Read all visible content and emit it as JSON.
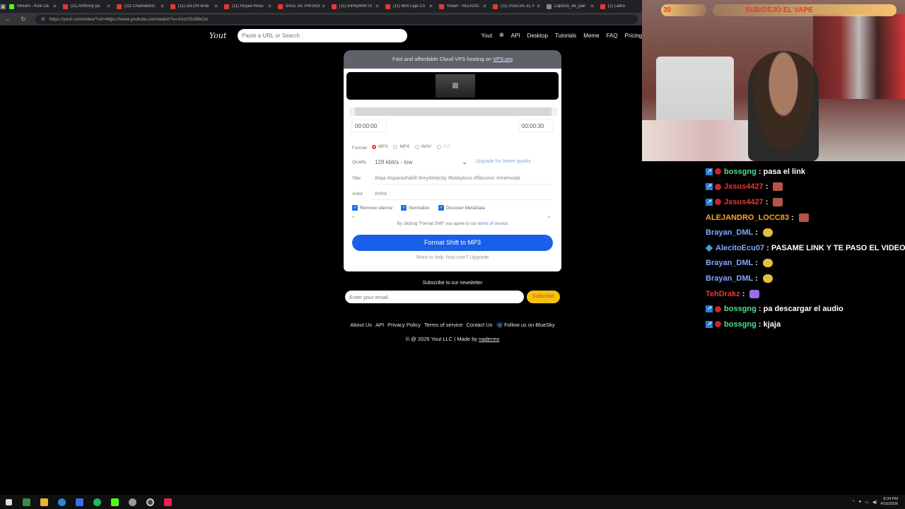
{
  "browser": {
    "tabs": [
      {
        "title": "Stream - Kick Da",
        "color": "#53fc18"
      },
      {
        "title": "(11) Anthony pa",
        "color": "#e53935"
      },
      {
        "title": "(11) Chamakitos",
        "color": "#e53935"
      },
      {
        "title": "(11) DILON BAB",
        "color": "#e53935"
      },
      {
        "title": "(11) RDjavi Reac",
        "color": "#e53935"
      },
      {
        "title": "SALE DE PRISION",
        "color": "#e53935"
      },
      {
        "title": "(11) ElReyWithTh",
        "color": "#e53935"
      },
      {
        "title": "(11) Mini Laja CS",
        "color": "#e53935"
      },
      {
        "title": "Yulian - RELIGIO",
        "color": "#e53935"
      },
      {
        "title": "(11) VUELVE EL R",
        "color": "#e53935"
      },
      {
        "title": "Captura_de_pan",
        "color": "#888888"
      },
      {
        "title": "(2) Ladro",
        "color": "#e53935"
      }
    ],
    "url": "https://yout.com/video/?url=https://www.youtube.com/watch?v=XAzGSABkCw"
  },
  "site": {
    "logo": "Yout",
    "search_placeholder": "Paste a URL or Search",
    "menu": [
      "Yout",
      "API",
      "Desktop",
      "Tutorials",
      "Meme",
      "FAQ",
      "Pricing"
    ],
    "vps_text": "Fast and affordable Cloud VPS hosting on",
    "vps_link": "VPS.org",
    "time_start": "00:00:00",
    "time_end": "00:00:30",
    "format_label": "Format",
    "formats": [
      "MP3",
      "MP4",
      "WAV",
      "GIF"
    ],
    "quality_label": "Quality",
    "quality_value": "128 kbit/s - low",
    "upgrade_quality": "Upgrade for better quality",
    "title_label": "Title",
    "title_value": "#laja #spanishdrill #reydelacity #babyloco #flacomc #memoab",
    "artist_label": "Artist",
    "artist_value": "Artist",
    "checks": [
      "Remove silence",
      "Normalize",
      "Discover MetaData"
    ],
    "agree_text": "By clicking \"Format Shift\" you agree to our",
    "agree_link": "terms of service",
    "cta": "Format Shift to MP3",
    "help": "Want to help Yout.com? Upgrade",
    "newsletter_title": "Subscribe to our newsletter",
    "email_placeholder": "Enter your email",
    "subscribe": "Subscribe",
    "footer_links": [
      "About Us",
      "API",
      "Privacy Policy",
      "Terms of service",
      "Contact Us"
    ],
    "bluesky": "Follow us on BlueSky",
    "copyright": "© @ 2026 Yout LLC | Made by",
    "author": "nadermx"
  },
  "stream": {
    "viewers": "39",
    "banner": "SUB/DEJO EL VAPE"
  },
  "chat": [
    {
      "user": "bossgng",
      "color": "#4ce08a",
      "text": "pasa el link",
      "badge": "kick",
      "emote": ""
    },
    {
      "user": "Jxsus4427",
      "color": "#e53935",
      "text": "",
      "badge": "kick",
      "emote": "brick"
    },
    {
      "user": "Jxsus4427",
      "color": "#e53935",
      "text": "",
      "badge": "kick",
      "emote": "brick"
    },
    {
      "user": "ALEJANDRO_LOCC83",
      "color": "#f4a629",
      "text": "",
      "badge": "",
      "emote": "brick"
    },
    {
      "user": "Brayan_DML",
      "color": "#7fa8ff",
      "text": "",
      "badge": "",
      "emote": "taxi"
    },
    {
      "user": "AlecitoEcu07",
      "color": "#7fa8ff",
      "text": "PASAME LINK Y TE PASO EL VIDEO",
      "badge": "cube",
      "emote": ""
    },
    {
      "user": "Brayan_DML",
      "color": "#7fa8ff",
      "text": "",
      "badge": "",
      "emote": "taxi"
    },
    {
      "user": "Brayan_DML",
      "color": "#7fa8ff",
      "text": "",
      "badge": "",
      "emote": "taxi"
    },
    {
      "user": "TehDrakz",
      "color": "#e53935",
      "text": "",
      "badge": "",
      "emote": "purple"
    },
    {
      "user": "bossgng",
      "color": "#4ce08a",
      "text": "pa descargar el audio",
      "badge": "kick",
      "emote": ""
    },
    {
      "user": "bossgng",
      "color": "#4ce08a",
      "text": "kjaja",
      "badge": "kick",
      "emote": ""
    }
  ],
  "taskbar": {
    "time": "8:34 PM",
    "date": "4/16/2026"
  }
}
